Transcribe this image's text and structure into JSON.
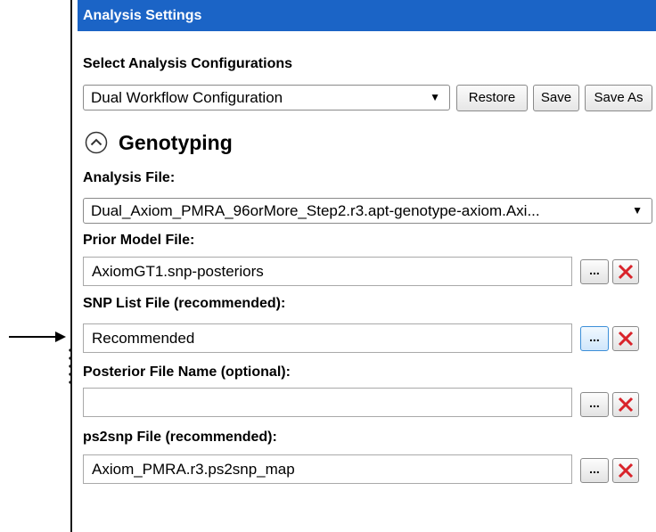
{
  "panel": {
    "title": "Analysis Settings"
  },
  "config": {
    "label": "Select Analysis Configurations",
    "selected": "Dual Workflow Configuration",
    "restore_label": "Restore",
    "save_label": "Save",
    "save_as_label": "Save As"
  },
  "section": {
    "title": "Genotyping",
    "icon": "collapse-chevron-up-icon"
  },
  "fields": {
    "analysis_file": {
      "label": "Analysis File:",
      "value": "Dual_Axiom_PMRA_96orMore_Step2.r3.apt-genotype-axiom.Axi..."
    },
    "prior_model": {
      "label": "Prior Model File:",
      "value": "AxiomGT1.snp-posteriors"
    },
    "snp_list": {
      "label": "SNP List File (recommended):",
      "value": "Recommended"
    },
    "posterior_file": {
      "label": "Posterior File Name (optional):",
      "value": ""
    },
    "ps2snp": {
      "label": "ps2snp File (recommended):",
      "value": "Axiom_PMRA.r3.ps2snp_map"
    }
  },
  "icons": {
    "browse": "ellipsis-icon",
    "clear": "red-x-icon",
    "pointer": "arrow-right-icon",
    "dropdown": "triangle-down-icon"
  },
  "browse_label": "...",
  "colors": {
    "titlebar": "#1b64c6",
    "clear_x": "#d9232a",
    "browse_active_border": "#3c8fd8"
  }
}
